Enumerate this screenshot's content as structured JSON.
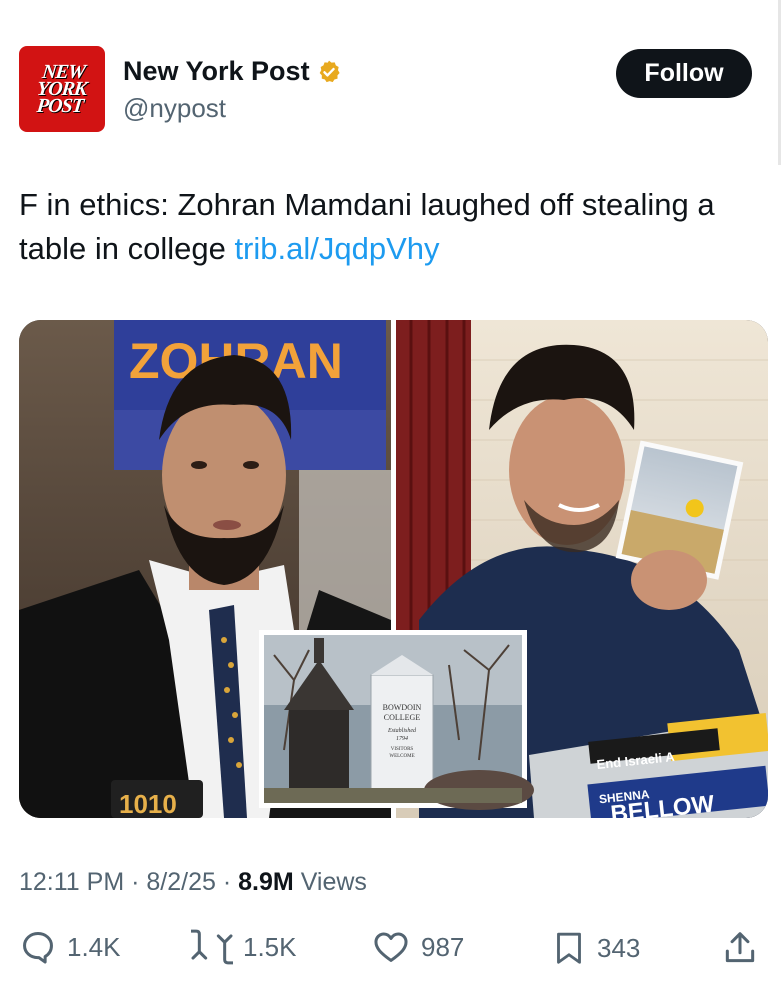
{
  "account": {
    "logo_lines": [
      "NEW",
      "YORK",
      "POST"
    ],
    "name": "New York Post",
    "handle": "@nypost",
    "follow_label": "Follow",
    "verified_color": "#e8a91f"
  },
  "tweet": {
    "text": "F in ethics: Zohran Mamdani laughed off stealing a table in college ",
    "link": "trib.al/JqdpVhy"
  },
  "media": {
    "sign_left": "ZOHRAN",
    "mic_label": "1010",
    "bowdoin_sign": [
      "BOWDOIN",
      "COLLEGE",
      "Established",
      "1794",
      "VISITORS",
      "WELCOME"
    ],
    "table_sticker_1": "End Israeli A",
    "table_sticker_2": "SHENNA",
    "table_sticker_3": "BELLOW"
  },
  "meta": {
    "time": "12:11 PM",
    "date": "8/2/25",
    "views_count": "8.9M",
    "views_label": "Views"
  },
  "actions": {
    "replies": "1.4K",
    "reposts": "1.5K",
    "likes": "987",
    "bookmarks": "343"
  },
  "colors": {
    "link": "#1d9bf0",
    "brand_red": "#d21313",
    "muted": "#536471"
  }
}
